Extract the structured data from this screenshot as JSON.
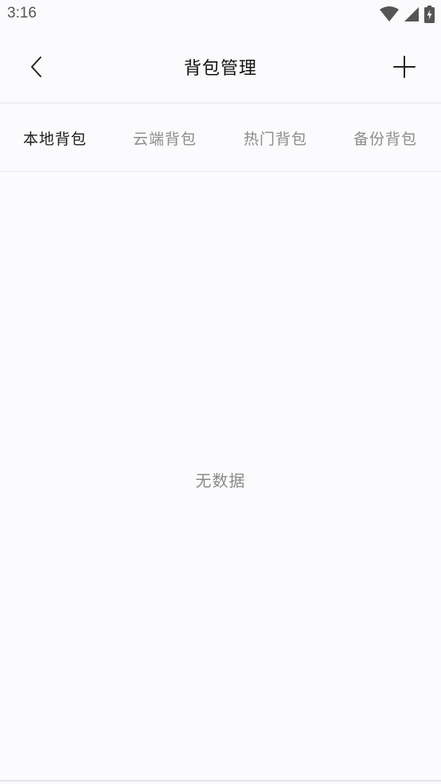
{
  "status_bar": {
    "time": "3:16",
    "icons": [
      "wifi-icon",
      "signal-icon",
      "battery-charging-icon"
    ]
  },
  "header": {
    "title": "背包管理",
    "back_icon": "chevron-left-icon",
    "add_icon": "plus-icon"
  },
  "tabs": [
    {
      "label": "本地背包",
      "active": true
    },
    {
      "label": "云端背包",
      "active": false
    },
    {
      "label": "热门背包",
      "active": false
    },
    {
      "label": "备份背包",
      "active": false
    }
  ],
  "content": {
    "empty_text": "无数据"
  },
  "colors": {
    "background": "#fbfbfd",
    "active_tab": "#1c1c1c",
    "inactive_tab": "#8c8c8c",
    "divider": "#e6e6ea"
  }
}
